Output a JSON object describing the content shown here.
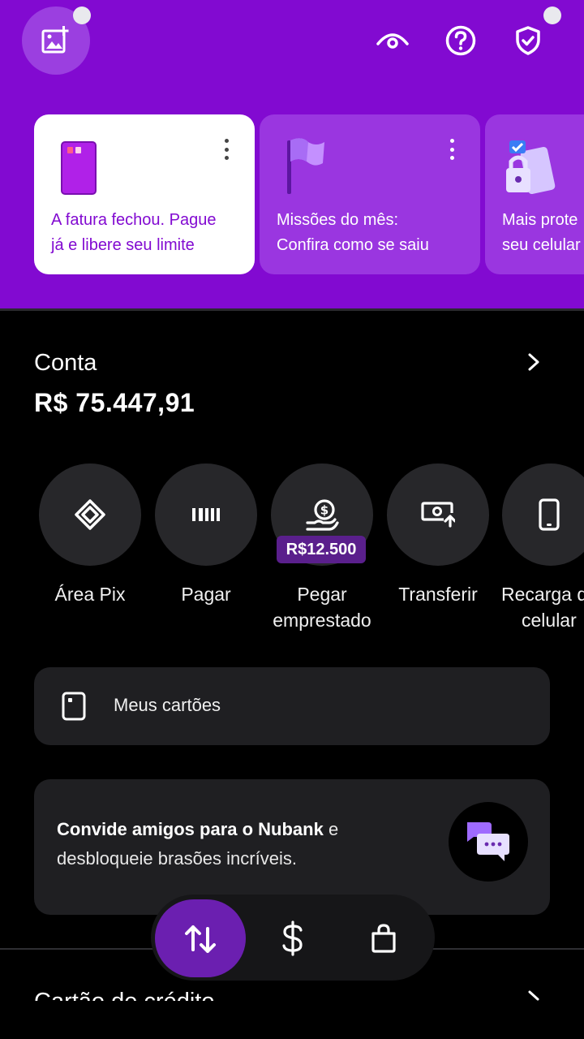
{
  "header": {
    "icons": [
      "add-photo-icon",
      "eye-icon",
      "help-icon",
      "shield-check-icon"
    ],
    "background": "#820ad1"
  },
  "cards": [
    {
      "text_line1": "A fatura fechou. Pague",
      "text_line2": "já e libere seu limite",
      "icon": "credit-card-icon"
    },
    {
      "text_line1": "Missões do mês:",
      "text_line2": "Confira como se saiu",
      "icon": "flag-icon"
    },
    {
      "text_line1": "Mais prote",
      "text_line2": "seu celular",
      "icon": "phone-lock-icon"
    }
  ],
  "account": {
    "title": "Conta",
    "balance": "R$ 75.447,91"
  },
  "actions": [
    {
      "label": "Área Pix",
      "icon": "pix-icon"
    },
    {
      "label": "Pagar",
      "icon": "barcode-icon"
    },
    {
      "label": "Pegar",
      "label2": "emprestado",
      "icon": "loan-hand-icon",
      "badge": "R$12.500"
    },
    {
      "label": "Transferir",
      "icon": "transfer-icon"
    },
    {
      "label": "Recarga de",
      "label2": "celular",
      "icon": "phone-icon"
    }
  ],
  "my_cards": {
    "label": "Meus cartões"
  },
  "invite": {
    "bold": "Convide amigos para o Nubank",
    "rest1": " e",
    "line2": "desbloqueie brasões incríveis."
  },
  "next_section": {
    "title": "Cartão de crédito"
  },
  "bottom_nav": {
    "items": [
      "transactions-icon",
      "dollar-icon",
      "shopping-bag-icon"
    ],
    "active": 0
  },
  "colors": {
    "accent": "#820ad1",
    "card_purple": "#9a36e0",
    "surface": "#1f1f22",
    "badge": "#5a1f8c"
  }
}
